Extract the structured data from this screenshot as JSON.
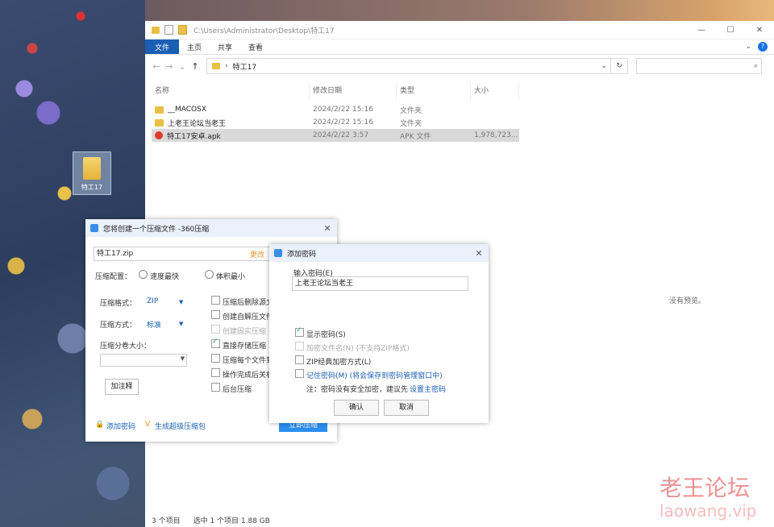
{
  "desktop": {
    "icon_label": "特工17"
  },
  "explorer": {
    "title_path": "C:\\Users\\Administrator\\Desktop\\特工17",
    "win_min": "—",
    "win_max": "☐",
    "win_close": "✕",
    "ribbon": {
      "file": "文件",
      "home": "主页",
      "share": "共享",
      "view": "查看",
      "chevron": "⌄",
      "help": "?"
    },
    "nav": {
      "back": "←",
      "forward": "→",
      "dropdown": "⌄",
      "up": "↑"
    },
    "address": {
      "crumb_sep": "›",
      "folder": "特工17",
      "dd": "⌄",
      "refresh": "↻"
    },
    "search": {
      "icon": "⌕",
      "placeholder": ""
    },
    "columns": {
      "name": "名称",
      "modified": "修改日期",
      "type": "类型",
      "size": "大小"
    },
    "files": [
      {
        "name": "__MACOSX",
        "modified": "2024/2/22 15:16",
        "type": "文件夹",
        "size": ""
      },
      {
        "name": "上老王论坛当老王",
        "modified": "2024/2/22 15:16",
        "type": "文件夹",
        "size": ""
      },
      {
        "name": "特工17安卓.apk",
        "modified": "2024/2/22 3:57",
        "type": "APK 文件",
        "size": "1,978,723..."
      }
    ],
    "no_preview": "没有预览。",
    "status": {
      "count": "3 个项目",
      "selected": "选中 1 个项目  1.88 GB"
    }
  },
  "zip_dialog": {
    "title": "您将创建一个压缩文件 -360压缩",
    "filename": "特工17.zip",
    "change": "更改",
    "config_label": "压缩配置：",
    "speed_option": "速度最快",
    "size_option": "体积最小",
    "format_label": "压缩格式：",
    "format_value": "ZIP",
    "method_label": "压缩方式：",
    "method_value": "标准",
    "volume_label": "压缩分卷大小：",
    "volume_value": "",
    "password_button": "加注释",
    "options": [
      "压缩后删除源文件",
      "创建自解压文件",
      "创建固实压缩",
      "直接存储压缩",
      "压缩每个文件到单独",
      "操作完成后关机",
      "后台压缩"
    ],
    "add_password_link": "添加密码",
    "gen_link": "生成超级压缩包",
    "start": "立即压缩"
  },
  "password_dialog": {
    "title": "添加密码",
    "input_label": "输入密码(E)",
    "password_value": "上老王论坛当老王",
    "show_password": "显示密码(S)",
    "encrypt_filenames": "加密文件名(N) (不支持ZIP格式)",
    "zip_classic": "ZIP经典加密方式(L)",
    "remember": "记住密码(M) (将会保存到密码管理窗口中)",
    "note_prefix": "注：密码没有安全加密，建议先",
    "note_link": "设置主密码",
    "ok": "确认",
    "cancel": "取消"
  },
  "watermark": {
    "cn": "老王论坛",
    "url": "laowang.vip"
  }
}
